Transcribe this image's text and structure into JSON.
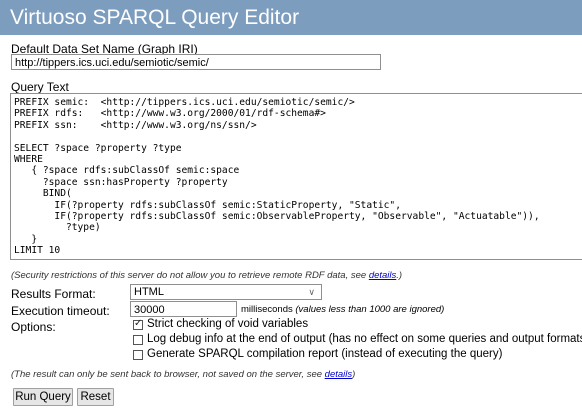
{
  "header": {
    "title": "Virtuoso SPARQL Query Editor"
  },
  "graph": {
    "label": "Default Data Set Name (Graph IRI)",
    "value": "http://tippers.ics.uci.edu/semiotic/semic/"
  },
  "query": {
    "label": "Query Text",
    "lines": [
      "PREFIX semic:  <http://tippers.ics.uci.edu/semiotic/semic/>",
      "PREFIX rdfs:   <http://www.w3.org/2000/01/rdf-schema#>",
      "PREFIX ssn:    <http://www.w3.org/ns/ssn/>",
      "",
      "SELECT ?space ?property ?type",
      "WHERE",
      "   { ?space rdfs:subClassOf semic:space",
      "     ?space ssn:hasProperty ?property",
      "     BIND(",
      "       IF(?property rdfs:subClassOf semic:StaticProperty, \"Static\",",
      "       IF(?property rdfs:subClassOf semic:ObservableProperty, \"Observable\", \"Actuatable\")),",
      "         ?type)",
      "   }",
      "LIMIT 10"
    ]
  },
  "security_note": {
    "text": "(Security restrictions of this server do not allow you to retrieve remote RDF data, see ",
    "link": "details",
    "suffix": ".)"
  },
  "results_format": {
    "label": "Results Format:",
    "value": "HTML"
  },
  "timeout": {
    "label": "Execution timeout:",
    "value": "30000",
    "unit": "milliseconds",
    "note": "(values less than 1000 are ignored)"
  },
  "options": {
    "label": "Options:",
    "items": [
      {
        "label": "Strict checking of void variables",
        "checked": true
      },
      {
        "label": "Log debug info at the end of output (has no effect on some queries and output formats)",
        "checked": false
      },
      {
        "label": "Generate SPARQL compilation report (instead of executing the query)",
        "checked": false
      }
    ]
  },
  "result_note": {
    "text": "(The result can only be sent back to browser, not saved on the server, see ",
    "link": "details",
    "suffix": ")"
  },
  "buttons": {
    "run": "Run Query",
    "reset": "Reset"
  }
}
